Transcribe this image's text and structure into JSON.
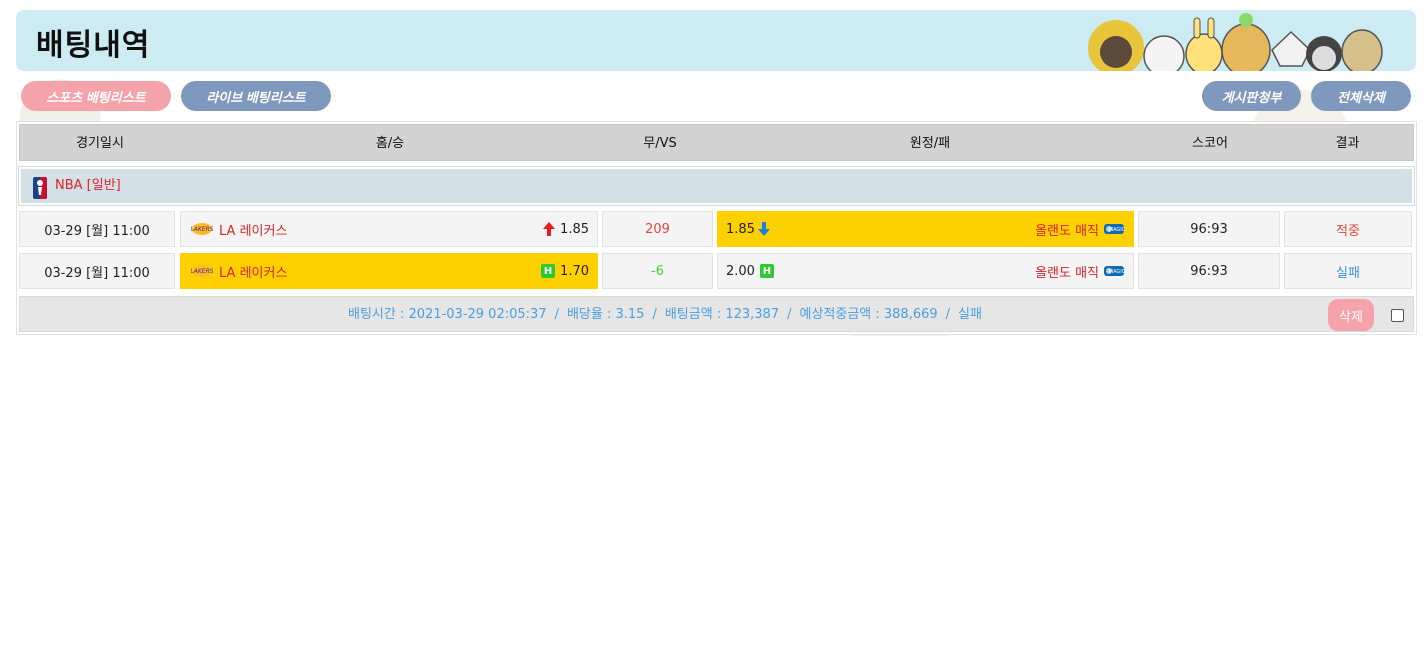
{
  "header": {
    "title": "배팅내역"
  },
  "tabs": {
    "sports": "스포츠 배팅리스트",
    "live": "라이브 배팅리스트"
  },
  "actions": {
    "post_request": "게시판청부",
    "delete_all": "전체삭제"
  },
  "table": {
    "columns": [
      "경기일시",
      "홈/승",
      "무/VS",
      "원정/패",
      "스코어",
      "결과"
    ],
    "league": "NBA [일반]",
    "rows": [
      {
        "datetime": "03-29 [월] 11:00",
        "home": "LA 레이커스",
        "home_odds": "1.85",
        "vs": "209",
        "away_odds": "1.85",
        "away": "올랜도 매직",
        "score": "96:93",
        "result": "적중",
        "home_indicator": "arrow-up-icon",
        "away_indicator": "arrow-down-icon",
        "picked": "away"
      },
      {
        "datetime": "03-29 [월] 11:00",
        "home": "LA 레이커스",
        "home_odds": "1.70",
        "vs": "-6",
        "away_odds": "2.00",
        "away": "올랜도 매직",
        "score": "96:93",
        "result": "실패",
        "home_indicator": "H",
        "away_indicator": "H",
        "picked": "home"
      }
    ]
  },
  "summary": {
    "bet_time": "배팅시간 : 2021-03-29 02:05:37",
    "odds": "배당율 : 3.15",
    "amount": "배팅금액 : 123,387",
    "expected": "예상적중금액 : 388,669",
    "status": "실패",
    "separator": "/",
    "delete_label": "삭제"
  },
  "colors": {
    "header_bg": "#cdebf3",
    "pill_pink": "#f4a3aa",
    "pill_blue": "#7f98bd",
    "picked_yellow": "#fed000",
    "team_red": "#d6232a",
    "summary_blue": "#4a9ee0"
  }
}
